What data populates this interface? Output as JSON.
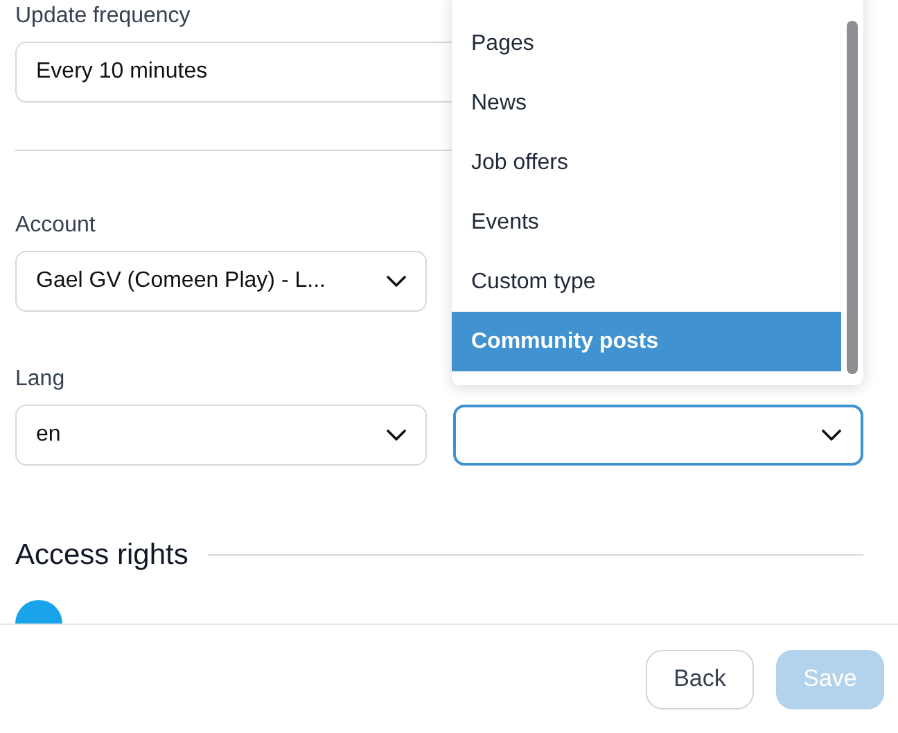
{
  "update_frequency": {
    "label": "Update frequency",
    "value": "Every 10 minutes"
  },
  "account": {
    "label": "Account",
    "value": "Gael GV (Comeen Play) - L..."
  },
  "lang": {
    "label": "Lang",
    "value": "en"
  },
  "type_dropdown": {
    "focused": true,
    "options": [
      {
        "label": "Pages",
        "selected": false
      },
      {
        "label": "News",
        "selected": false
      },
      {
        "label": "Job offers",
        "selected": false
      },
      {
        "label": "Events",
        "selected": false
      },
      {
        "label": "Custom type",
        "selected": false
      },
      {
        "label": "Community posts",
        "selected": true
      }
    ]
  },
  "access_rights": {
    "title": "Access rights"
  },
  "buttons": [
    {
      "label": "Back",
      "kind": "secondary",
      "disabled": false
    },
    {
      "label": "Save",
      "kind": "primary",
      "disabled": true
    }
  ]
}
